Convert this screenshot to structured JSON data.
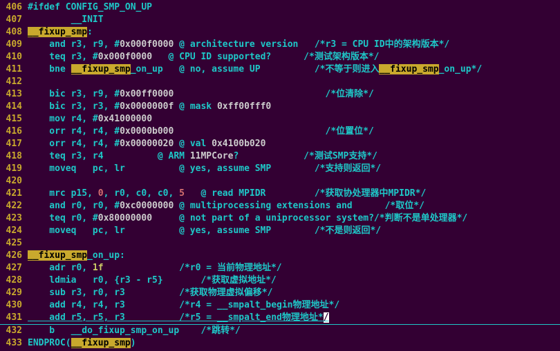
{
  "lines": [
    {
      "n": "406",
      "t": "#ifdef CONFIG_SMP_ON_UP"
    },
    {
      "n": "407",
      "t": "        __INIT"
    },
    {
      "n": "408",
      "raw": [
        {
          "c": "hl",
          "t": "__fixup_smp"
        },
        {
          "c": "",
          "t": ":"
        }
      ]
    },
    {
      "n": "409",
      "raw": [
        {
          "c": "",
          "t": "    and r3, r9, #"
        },
        {
          "c": "id",
          "t": "0x000f0000"
        },
        {
          "c": "",
          "t": " @ architecture version   /*r3 = CPU ID中的架构版本*/"
        }
      ]
    },
    {
      "n": "410",
      "raw": [
        {
          "c": "",
          "t": "    teq r3, #"
        },
        {
          "c": "id",
          "t": "0x000f0000"
        },
        {
          "c": "",
          "t": "   @ CPU ID supported?      /*测试架构版本*/"
        }
      ]
    },
    {
      "n": "411",
      "raw": [
        {
          "c": "",
          "t": "    bne "
        },
        {
          "c": "hl",
          "t": "__fixup_smp"
        },
        {
          "c": "",
          "t": "_on_up   @ no, assume UP          /*不等于则进入"
        },
        {
          "c": "hl",
          "t": "__fixup_smp"
        },
        {
          "c": "",
          "t": "_on_up*/"
        }
      ]
    },
    {
      "n": "412",
      "t": ""
    },
    {
      "n": "413",
      "raw": [
        {
          "c": "",
          "t": "    bic r3, r9, #"
        },
        {
          "c": "id",
          "t": "0x00ff0000"
        },
        {
          "c": "",
          "t": "                            /*位清除*/"
        }
      ]
    },
    {
      "n": "414",
      "raw": [
        {
          "c": "",
          "t": "    bic r3, r3, #"
        },
        {
          "c": "id",
          "t": "0x0000000f"
        },
        {
          "c": "",
          "t": " @ mask "
        },
        {
          "c": "id",
          "t": "0xff00fff0"
        }
      ]
    },
    {
      "n": "415",
      "raw": [
        {
          "c": "",
          "t": "    mov r4, #"
        },
        {
          "c": "id",
          "t": "0x41000000"
        }
      ]
    },
    {
      "n": "416",
      "raw": [
        {
          "c": "",
          "t": "    orr r4, r4, #"
        },
        {
          "c": "id",
          "t": "0x0000b000"
        },
        {
          "c": "",
          "t": "                            /*位置位*/"
        }
      ]
    },
    {
      "n": "417",
      "raw": [
        {
          "c": "",
          "t": "    orr r4, r4, #"
        },
        {
          "c": "id",
          "t": "0x00000020"
        },
        {
          "c": "",
          "t": " @ val "
        },
        {
          "c": "id",
          "t": "0x4100b020"
        }
      ]
    },
    {
      "n": "418",
      "raw": [
        {
          "c": "",
          "t": "    teq r3, r4          @ ARM "
        },
        {
          "c": "id",
          "t": "11MPCore"
        },
        {
          "c": "",
          "t": "?            /*测试SMP支持*/"
        }
      ]
    },
    {
      "n": "419",
      "raw": [
        {
          "c": "",
          "t": "    moveq   pc, lr          @ yes, assume SMP        /*支持则返回*/"
        }
      ]
    },
    {
      "n": "420",
      "t": ""
    },
    {
      "n": "421",
      "raw": [
        {
          "c": "",
          "t": "    mrc p15, "
        },
        {
          "c": "num",
          "t": "0"
        },
        {
          "c": "",
          "t": ", r0, c0, c0, "
        },
        {
          "c": "num",
          "t": "5"
        },
        {
          "c": "",
          "t": "   @ read MPIDR         /*获取协处理器中MPIDR*/"
        }
      ]
    },
    {
      "n": "422",
      "raw": [
        {
          "c": "",
          "t": "    and r0, r0, #"
        },
        {
          "c": "id",
          "t": "0xc0000000"
        },
        {
          "c": "",
          "t": " @ multiprocessing extensions and      /*取位*/"
        }
      ]
    },
    {
      "n": "423",
      "raw": [
        {
          "c": "",
          "t": "    teq r0, #"
        },
        {
          "c": "id",
          "t": "0x80000000"
        },
        {
          "c": "",
          "t": "     @ not part of a uniprocessor system?/*判断不是单处理器*/"
        }
      ]
    },
    {
      "n": "424",
      "raw": [
        {
          "c": "",
          "t": "    moveq   pc, lr          @ yes, assume SMP        /*不是则返回*/"
        }
      ]
    },
    {
      "n": "425",
      "t": ""
    },
    {
      "n": "426",
      "raw": [
        {
          "c": "hl",
          "t": "__fixup_smp"
        },
        {
          "c": "",
          "t": "_on_up:"
        }
      ]
    },
    {
      "n": "427",
      "raw": [
        {
          "c": "",
          "t": "    adr r0, "
        },
        {
          "c": "keylight",
          "t": "1f"
        },
        {
          "c": "",
          "t": "              /*r0 = 当前物理地址*/"
        }
      ]
    },
    {
      "n": "428",
      "raw": [
        {
          "c": "",
          "t": "    ldmia   r0, {r3 - r5}       /*获取虚拟地址*/"
        }
      ]
    },
    {
      "n": "429",
      "raw": [
        {
          "c": "",
          "t": "    sub r3, r0, r3          /*获取物理虚拟偏移*/"
        }
      ]
    },
    {
      "n": "430",
      "raw": [
        {
          "c": "",
          "t": "    add r4, r4, r3          /*r4 = __smpalt_begin物理地址*/"
        }
      ]
    },
    {
      "n": "431",
      "sel": true,
      "raw": [
        {
          "c": "",
          "t": "    add r5, r5, r3          /*r5 = __smpalt_end物理地址*"
        },
        {
          "c": "cursor",
          "t": "/"
        }
      ]
    },
    {
      "n": "432",
      "raw": [
        {
          "c": "",
          "t": "    b   __do_fixup_smp_on_up    /*跳转*/"
        }
      ]
    },
    {
      "n": "433",
      "raw": [
        {
          "c": "",
          "t": "ENDPROC("
        },
        {
          "c": "hl",
          "t": "__fixup_smp"
        },
        {
          "c": "",
          "t": ")"
        }
      ]
    }
  ]
}
